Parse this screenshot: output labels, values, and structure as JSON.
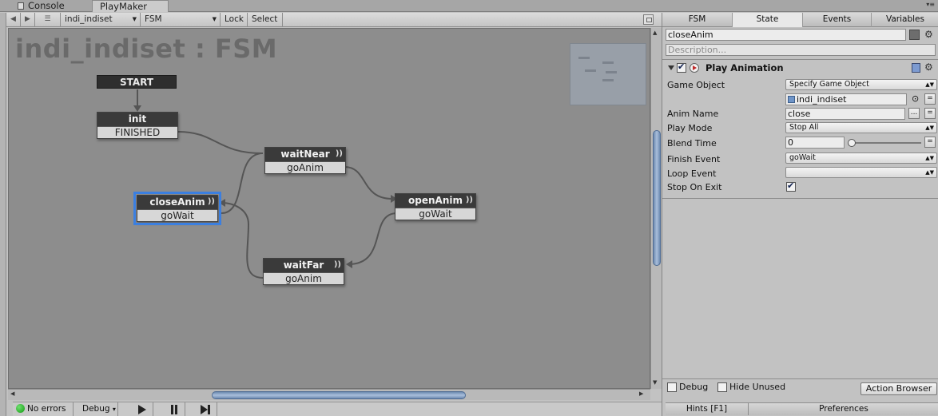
{
  "window_tabs": {
    "console": "Console",
    "playmaker": "PlayMaker",
    "menu_glyph": "▾≡"
  },
  "toolbar": {
    "back_glyph": "◀",
    "forward_glyph": "▶",
    "list_glyph": "☰",
    "fsm_owner": "indi_indiset",
    "fsm_name": "FSM",
    "lock": "Lock",
    "select": "Select"
  },
  "graph": {
    "title": "indi_indiset : FSM",
    "start_label": "START",
    "states": [
      {
        "name": "init",
        "event": "FINISHED",
        "selected": false,
        "has_action_icon": false
      },
      {
        "name": "waitNear",
        "event": "goAnim",
        "selected": false,
        "has_action_icon": true
      },
      {
        "name": "openAnim",
        "event": "goWait",
        "selected": false,
        "has_action_icon": true
      },
      {
        "name": "closeAnim",
        "event": "goWait",
        "selected": true,
        "has_action_icon": true
      },
      {
        "name": "waitFar",
        "event": "goAnim",
        "selected": false,
        "has_action_icon": true
      }
    ],
    "action_icon_glyph": "))",
    "colors": {
      "canvas": "#8d8d8d",
      "state_header": "#3a3a3a",
      "selection": "#3b7fe0"
    }
  },
  "scroll": {
    "up": "▲",
    "down": "▼",
    "left": "◀",
    "right": "▶"
  },
  "bottombar": {
    "status": "No errors",
    "debug": "Debug",
    "caret": "▾"
  },
  "inspector": {
    "tabs": [
      "FSM",
      "State",
      "Events",
      "Variables"
    ],
    "active_tab": "State",
    "state_name": "closeAnim",
    "description_placeholder": "Description...",
    "gear_glyph": "⚙",
    "action": {
      "title": "Play Animation",
      "enabled": true,
      "params": {
        "game_object": {
          "label": "Game Object",
          "mode": "Specify Game Object",
          "value": "indi_indiset"
        },
        "anim_name": {
          "label": "Anim Name",
          "value": "close",
          "browse": "...",
          "menu": "="
        },
        "play_mode": {
          "label": "Play Mode",
          "value": "Stop All"
        },
        "blend_time": {
          "label": "Blend Time",
          "value": "0",
          "slider": 0
        },
        "finish_event": {
          "label": "Finish Event",
          "value": "goWait"
        },
        "loop_event": {
          "label": "Loop Event",
          "value": ""
        },
        "stop_on_exit": {
          "label": "Stop On Exit",
          "checked": true
        }
      }
    },
    "debug_label": "Debug",
    "hide_unused_label": "Hide Unused",
    "action_browser": "Action Browser",
    "hints": "Hints [F1]",
    "preferences": "Preferences"
  }
}
